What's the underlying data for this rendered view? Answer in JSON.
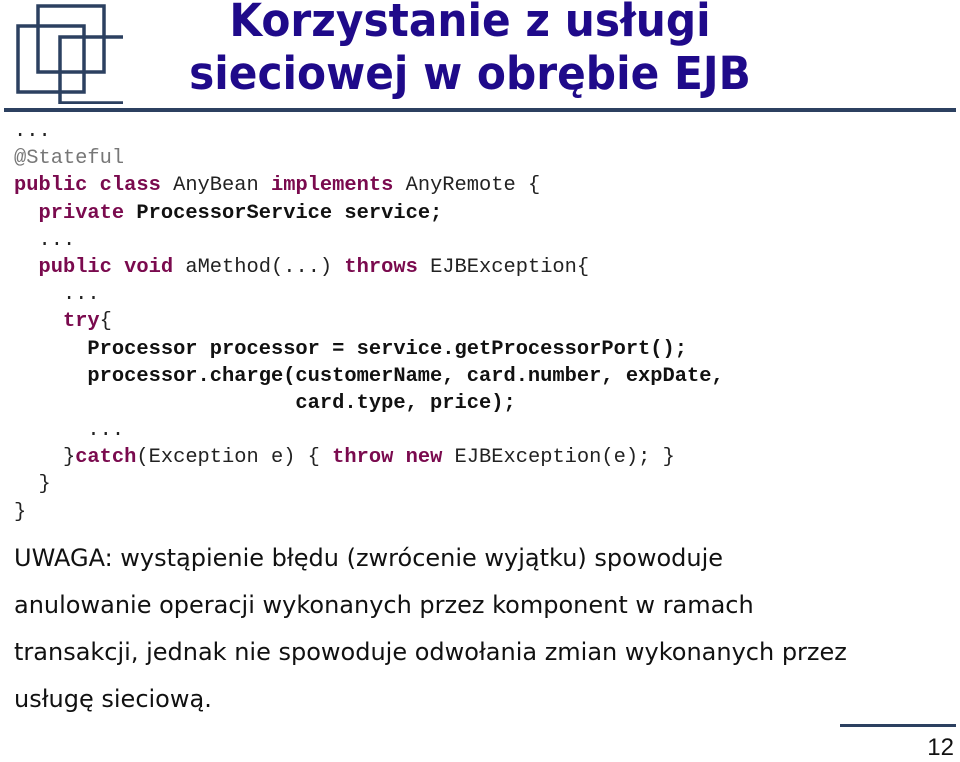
{
  "slide": {
    "title_line1": "Korzystanie z usługi",
    "title_line2": "sieciowej w obrębie EJB",
    "logo_icon": "overlapping-squares-logo",
    "page_number": "12",
    "colors": {
      "title": "#1f0a8a",
      "rule": "#2c4060",
      "keyword": "#7a0a4e",
      "annotation": "#777777"
    }
  },
  "code": {
    "lines": [
      [
        {
          "t": "...",
          "c": "p"
        }
      ],
      [
        {
          "t": "@Stateful",
          "c": "an"
        }
      ],
      [
        {
          "t": "public class",
          "c": "kw"
        },
        {
          "t": " AnyBean ",
          "c": "p"
        },
        {
          "t": "implements",
          "c": "kw"
        },
        {
          "t": " AnyRemote {",
          "c": "p"
        }
      ],
      [
        {
          "t": "  ",
          "c": "p"
        },
        {
          "t": "private",
          "c": "kw"
        },
        {
          "t": " ProcessorService service;",
          "c": "b"
        }
      ],
      [
        {
          "t": "  ...",
          "c": "p"
        }
      ],
      [
        {
          "t": "  ",
          "c": "p"
        },
        {
          "t": "public void",
          "c": "kw"
        },
        {
          "t": " aMethod(...) ",
          "c": "p"
        },
        {
          "t": "throws",
          "c": "kw"
        },
        {
          "t": " EJBException{",
          "c": "p"
        }
      ],
      [
        {
          "t": "    ...",
          "c": "p"
        }
      ],
      [
        {
          "t": "    ",
          "c": "p"
        },
        {
          "t": "try",
          "c": "kw"
        },
        {
          "t": "{",
          "c": "p"
        }
      ],
      [
        {
          "t": "      Processor processor = service.getProcessorPort();",
          "c": "b"
        }
      ],
      [
        {
          "t": "      processor.charge(customerName, card.number, expDate,",
          "c": "b"
        }
      ],
      [
        {
          "t": "                       card.type, price);",
          "c": "b"
        }
      ],
      [
        {
          "t": "      ...",
          "c": "p"
        }
      ],
      [
        {
          "t": "    }",
          "c": "p"
        },
        {
          "t": "catch",
          "c": "kw"
        },
        {
          "t": "(Exception e) { ",
          "c": "p"
        },
        {
          "t": "throw new",
          "c": "kw"
        },
        {
          "t": " EJBException(e); }",
          "c": "p"
        }
      ],
      [
        {
          "t": "  }",
          "c": "p"
        }
      ],
      [
        {
          "t": "}",
          "c": "p"
        }
      ]
    ]
  },
  "note": {
    "lines": [
      "UWAGA: wystąpienie błędu (zwrócenie wyjątku) spowoduje",
      "anulowanie operacji wykonanych przez komponent w ramach",
      "transakcji, jednak nie spowoduje odwołania zmian wykonanych przez",
      "usługę sieciową."
    ]
  }
}
